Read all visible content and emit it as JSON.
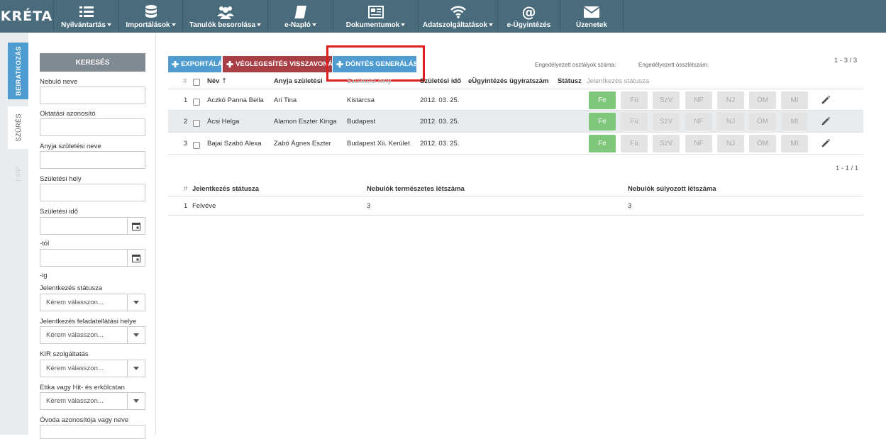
{
  "app": {
    "logo": "KRÉTA"
  },
  "nav": [
    {
      "label": "Nyilvántartás",
      "icon": "list-icon",
      "caret": true
    },
    {
      "label": "Importálások",
      "icon": "database-icon",
      "caret": true
    },
    {
      "label": "Tanulók besorolása",
      "icon": "users-icon",
      "caret": true
    },
    {
      "label": "e-Napló",
      "icon": "book-icon",
      "caret": true
    },
    {
      "label": "Dokumentumok",
      "icon": "newspaper-icon",
      "caret": true
    },
    {
      "label": "Adatszolgáltatások",
      "icon": "wifi-icon",
      "caret": true
    },
    {
      "label": "e-Ügyintézés",
      "icon": "at-icon",
      "caret": false
    },
    {
      "label": "Üzenetek",
      "icon": "envelope-icon",
      "caret": false
    }
  ],
  "sidetabs": {
    "beiratkozas": "BEIRATKOZÁS",
    "szures": "SZŰRÉS",
    "tipp": "TIPP"
  },
  "filter": {
    "search_button": "KERESÉS",
    "nebulo_neve": "Nebuló neve",
    "oktatasi_azonosito": "Oktatási azonosító",
    "anyja_szuletesi_neve": "Anyja születési neve",
    "szuletesi_hely": "Születési hely",
    "szuletesi_ido": "Születési idő",
    "tol": "-tól",
    "ig": "-ig",
    "jelentkezes_statusza": "Jelentkezés státusza",
    "jelentkezes_feladatellatasi_helye": "Jelentkezés feladatellátási helye",
    "kir_szolgaltatas": "KIR szolgáltatás",
    "etika": "Etika vagy Hit- és erkölcstan",
    "ovoda": "Óvoda azonosítója vagy neve",
    "select_placeholder": "Kérem válasszon..."
  },
  "toolbar": {
    "export": "EXPORTÁLÁS",
    "veglegesites": "VÉGLEGESÍTÉS VISSZAVONÁSA",
    "dontes": "DÖNTÉS GENERÁLÁSA",
    "engedelyezett_osztalyok": "Engedélyezett osztályok száma:",
    "engedelyezett_osszletszam": "Engedélyezett összlétszám:",
    "pager_top": "1 - 3 / 3"
  },
  "table": {
    "headers": {
      "num": "#",
      "nev": "Név",
      "anyja": "Anyja születési",
      "szul_hely": "Születési hely",
      "szul_ido": "Születési idő",
      "eugy": "eÜgyintézés ügyiratszám",
      "statusz": "Státusz",
      "jelentkezes": "Jelentkezés státusza"
    },
    "status_labels": [
      "Fe",
      "Fü",
      "SzV",
      "NF",
      "NJ",
      "ÓM",
      "MI"
    ],
    "rows": [
      {
        "num": "1",
        "nev": "Aczkó Panna Bella",
        "anyja": "Ari Tina",
        "hely": "Kistarcsa",
        "ido": "2012. 03. 25.",
        "active": "Fe"
      },
      {
        "num": "2",
        "nev": "Ácsi Helga",
        "anyja": "Alamon Eszter Kinga",
        "hely": "Budapest",
        "ido": "2012. 03. 25.",
        "active": "Fe"
      },
      {
        "num": "3",
        "nev": "Bajai Szabó Alexa",
        "anyja": "Zabó Ágnes Eszter",
        "hely": "Budapest Xii. Kerület",
        "ido": "2012. 03. 25.",
        "active": "Fe"
      }
    ]
  },
  "summary": {
    "pager": "1 - 1 / 1",
    "headers": {
      "num": "#",
      "statusz": "Jelentkezés státusza",
      "termeszetes": "Nebulók természetes létszáma",
      "sulyozott": "Nebulók súlyozott létszáma"
    },
    "rows": [
      {
        "num": "1",
        "statusz": "Felvéve",
        "termeszetes": "3",
        "sulyozott": "3"
      }
    ]
  },
  "colors": {
    "nav_bg": "#4a6b7c",
    "accent_blue": "#4f9cd1",
    "accent_red": "#a83f44",
    "status_active": "#7fc77a",
    "highlight": "#e01e1e"
  }
}
